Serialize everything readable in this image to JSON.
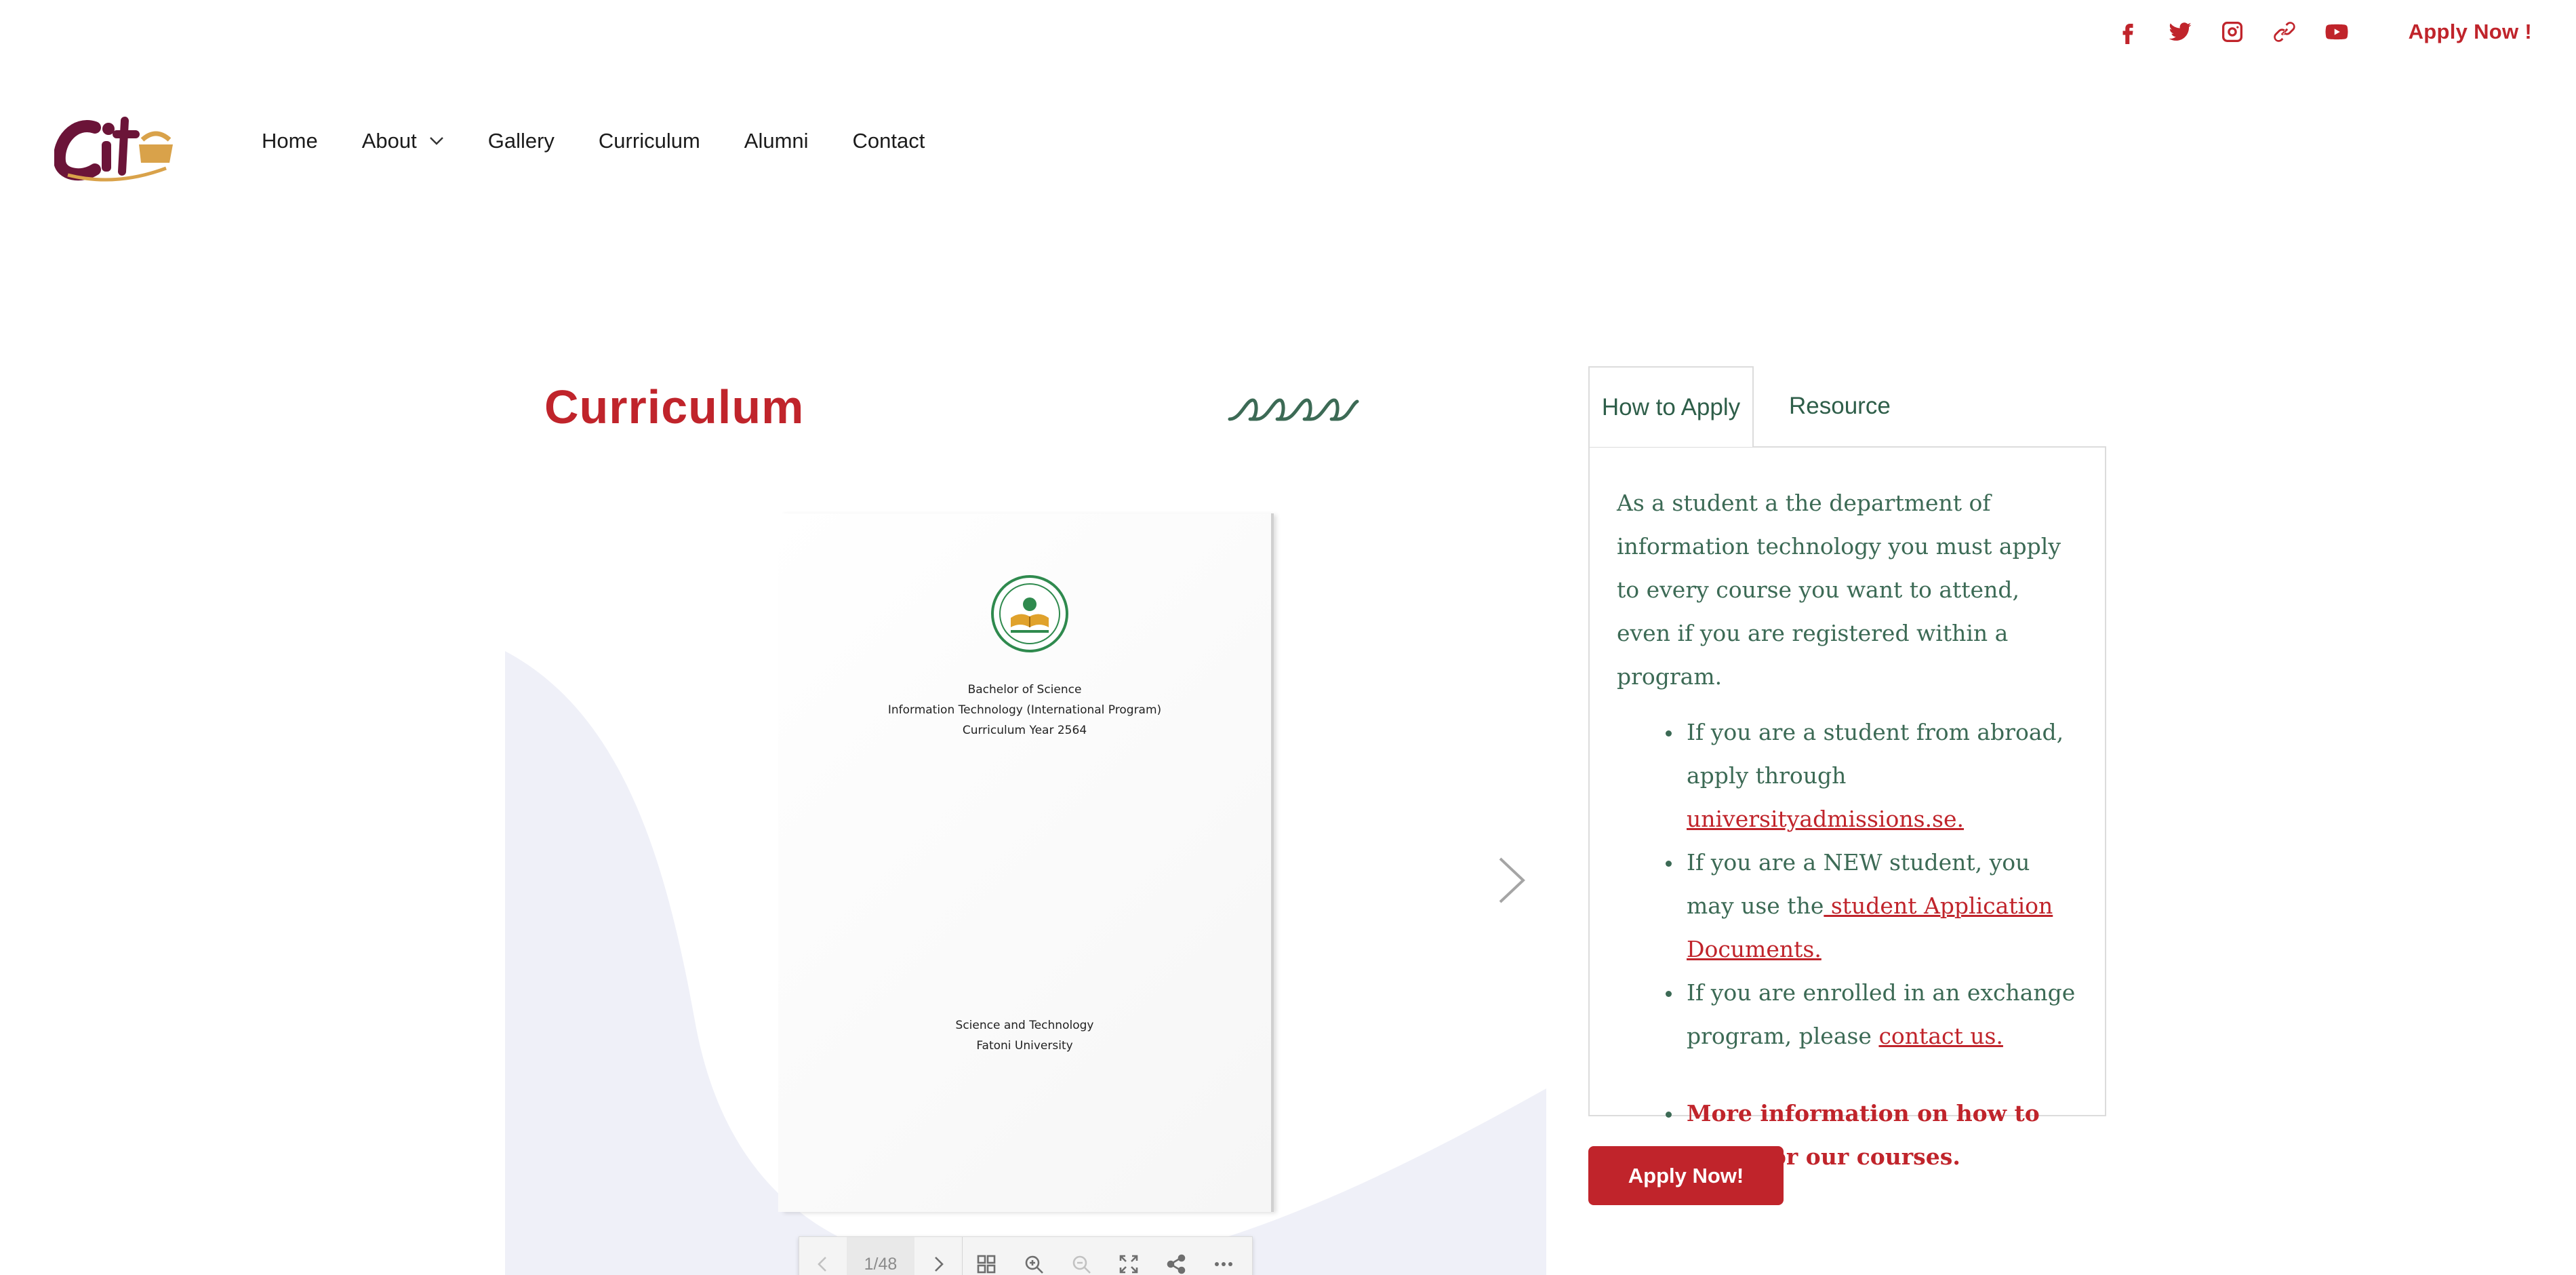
{
  "colors": {
    "brand_red": "#c0242b",
    "brand_green": "#3c6a55",
    "wave_bg": "#eff0f8"
  },
  "social": {
    "icons": [
      "facebook-icon",
      "twitter-icon",
      "instagram-icon",
      "link-icon",
      "youtube-icon"
    ],
    "apply_label": "Apply Now !"
  },
  "logo": {
    "text": "cit"
  },
  "nav": {
    "items": [
      {
        "label": "Home"
      },
      {
        "label": "About",
        "has_dropdown": true
      },
      {
        "label": "Gallery"
      },
      {
        "label": "Curriculum"
      },
      {
        "label": "Alumni"
      },
      {
        "label": "Contact"
      }
    ]
  },
  "main": {
    "title": "Curriculum"
  },
  "document": {
    "cover_lines": [
      "Bachelor of Science",
      "Information Technology (International Program)",
      "Curriculum Year 2564"
    ],
    "footer_lines": [
      "Science and Technology",
      "Fatoni  University"
    ],
    "page_indicator": "1/48"
  },
  "sidebar": {
    "tabs": [
      {
        "label": "How to Apply",
        "active": true
      },
      {
        "label": "Resource",
        "active": false
      }
    ],
    "intro": "As a student a the department of information technology you must apply to every course you want to attend, even if you are registered within a program.",
    "bullets": [
      {
        "text": "If you are a student from abroad, apply through ",
        "link": "universityadmissions.se."
      },
      {
        "text": "If you are a NEW student, you may use the",
        "link": " student Application Documents."
      },
      {
        "text": "If you are enrolled in an exchange program, please ",
        "link": "contact us."
      }
    ],
    "more_info": "More information on how to apply for our courses.",
    "apply_button": "Apply Now!"
  }
}
